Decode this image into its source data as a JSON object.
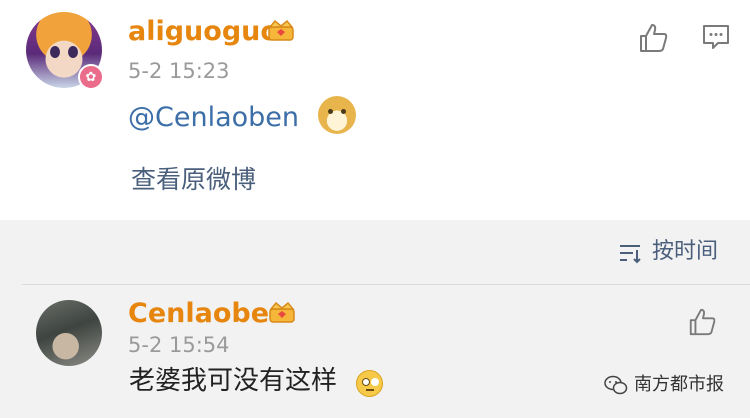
{
  "post": {
    "username": "aliguoguo",
    "timestamp": "5-2 15:23",
    "mention": "@Cenlaoben",
    "view_original": "查看原微博"
  },
  "replies_header": {
    "sort_label": "按时间"
  },
  "reply": {
    "username": "Cenlaoben",
    "timestamp": "5-2 15:54",
    "text": "老婆我可没有这样"
  },
  "watermark": {
    "text": "南方都市报"
  },
  "icons": [
    "vip-crown-icon",
    "thumbs-up-icon",
    "comment-icon",
    "sort-icon",
    "doge-emoji",
    "eye-roll-emoji",
    "wechat-watermark-icon",
    "vip-rabbit-badge-icon"
  ],
  "colors": {
    "username": "#e6860f",
    "link": "#3c6ea8",
    "secondary_text": "#9a9a9a",
    "reply_bg": "#f2f2f2"
  }
}
